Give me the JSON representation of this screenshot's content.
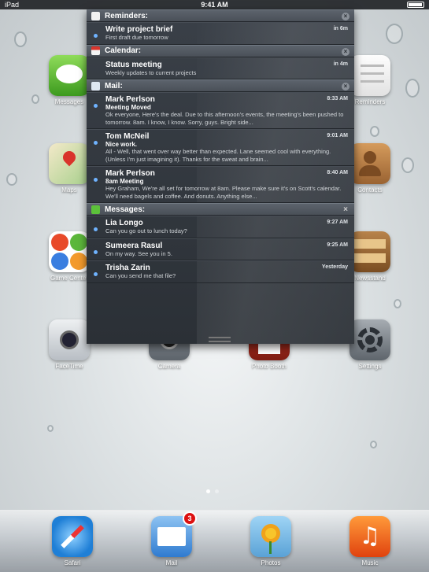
{
  "status_bar": {
    "carrier": "iPad",
    "time": "9:41 AM"
  },
  "apps": {
    "messages": "Messages",
    "reminders": "Reminders",
    "maps": "Maps",
    "contacts": "Contacts",
    "game_center": "Game Center",
    "newsstand": "Newsstand",
    "facetime": "FaceTime",
    "camera": "Camera",
    "photo_booth": "Photo Booth",
    "settings": "Settings"
  },
  "notification_center": {
    "reminders": {
      "title": "Reminders:",
      "items": [
        {
          "title": "Write project brief",
          "body": "First draft due tomorrow",
          "time": "in 6m"
        }
      ]
    },
    "calendar": {
      "title": "Calendar:",
      "items": [
        {
          "title": "Status meeting",
          "body": "Weekly updates to current projects",
          "time": "in 4m"
        }
      ]
    },
    "mail": {
      "title": "Mail:",
      "items": [
        {
          "sender": "Mark Perlson",
          "subject": "Meeting Moved",
          "body": "Ok everyone, Here's the deal. Due to this afternoon's events, the meeting's been pushed to tomorrow. 8am. I know, I know. Sorry, guys. Bright side...",
          "time": "8:33 AM"
        },
        {
          "sender": "Tom McNeil",
          "subject": "Nice work.",
          "body": "All - Well, that went over way better than expected. Lane seemed cool with everything. (Unless I'm just imagining it). Thanks for the sweat and brain...",
          "time": "9:01 AM"
        },
        {
          "sender": "Mark Perlson",
          "subject": "8am Meeting",
          "body": "Hey Graham, We're all set for tomorrow at 8am. Please make sure it's on Scott's calendar. We'll need bagels and coffee. And donuts. Anything else...",
          "time": "8:40 AM"
        }
      ]
    },
    "messages": {
      "title": "Messages:",
      "items": [
        {
          "sender": "Lia Longo",
          "body": "Can you go out to lunch today?",
          "time": "9:27 AM"
        },
        {
          "sender": "Sumeera Rasul",
          "body": "On my way. See you in 5.",
          "time": "9:25 AM"
        },
        {
          "sender": "Trisha Zarin",
          "body": "Can you send me that file?",
          "time": "Yesterday"
        }
      ]
    }
  },
  "dock": {
    "safari": "Safari",
    "mail": "Mail",
    "mail_badge": "3",
    "photos": "Photos",
    "music": "Music"
  }
}
